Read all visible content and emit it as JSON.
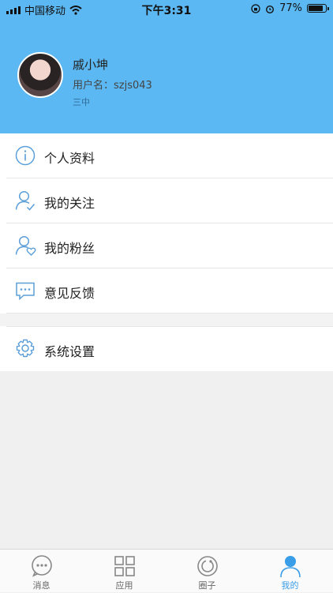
{
  "status_bar": {
    "carrier": "中国移动",
    "time": "下午3:31",
    "battery_percent": "77%",
    "battery_level": 0.77
  },
  "profile": {
    "nickname": "戚小坤",
    "username": "用户名：szjs043",
    "school": "三中"
  },
  "menu": {
    "items": [
      {
        "label": "个人资料",
        "icon": "info-icon"
      },
      {
        "label": "我的关注",
        "icon": "user-check-icon"
      },
      {
        "label": "我的粉丝",
        "icon": "user-heart-icon"
      },
      {
        "label": "意见反馈",
        "icon": "chat-icon"
      }
    ],
    "settings": {
      "label": "系统设置",
      "icon": "gear-icon"
    }
  },
  "tabbar": {
    "tabs": [
      {
        "label": "消息",
        "icon": "message-icon"
      },
      {
        "label": "应用",
        "icon": "grid-icon"
      },
      {
        "label": "圈子",
        "icon": "circle-icon"
      },
      {
        "label": "我的",
        "icon": "person-icon"
      }
    ],
    "active_index": 3
  },
  "colors": {
    "header": "#5cb8f2",
    "accent": "#3a9de8",
    "icon": "#5c9fd8"
  }
}
